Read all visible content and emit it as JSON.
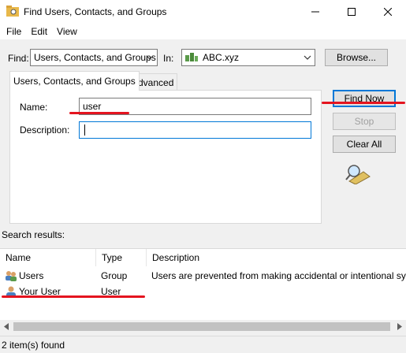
{
  "window": {
    "title": "Find Users, Contacts, and Groups"
  },
  "menu": [
    "File",
    "Edit",
    "View"
  ],
  "find": {
    "find_label": "Find:",
    "find_value": "Users, Contacts, and Groups",
    "in_label": "In:",
    "in_value": "ABC.xyz",
    "browse_label": "Browse..."
  },
  "tabs": [
    "Users, Contacts, and Groups",
    "Advanced"
  ],
  "form": {
    "name_label": "Name:",
    "name_value": "user",
    "description_label": "Description:",
    "description_value": ""
  },
  "buttons": {
    "find_now": "Find Now",
    "stop": "Stop",
    "clear_all": "Clear All"
  },
  "results": {
    "label": "Search results:",
    "columns": [
      "Name",
      "Type",
      "Description"
    ],
    "rows": [
      {
        "name": "Users",
        "type": "Group",
        "description": "Users are prevented from making accidental or intentional sys",
        "icon": "group-icon"
      },
      {
        "name": "Your User",
        "type": "User",
        "description": "",
        "icon": "user-icon"
      }
    ]
  },
  "status": {
    "text": "2 item(s) found"
  },
  "colors": {
    "accent": "#0078d7",
    "annotation_red": "#e4141f",
    "selection": "#e5f1fb"
  }
}
